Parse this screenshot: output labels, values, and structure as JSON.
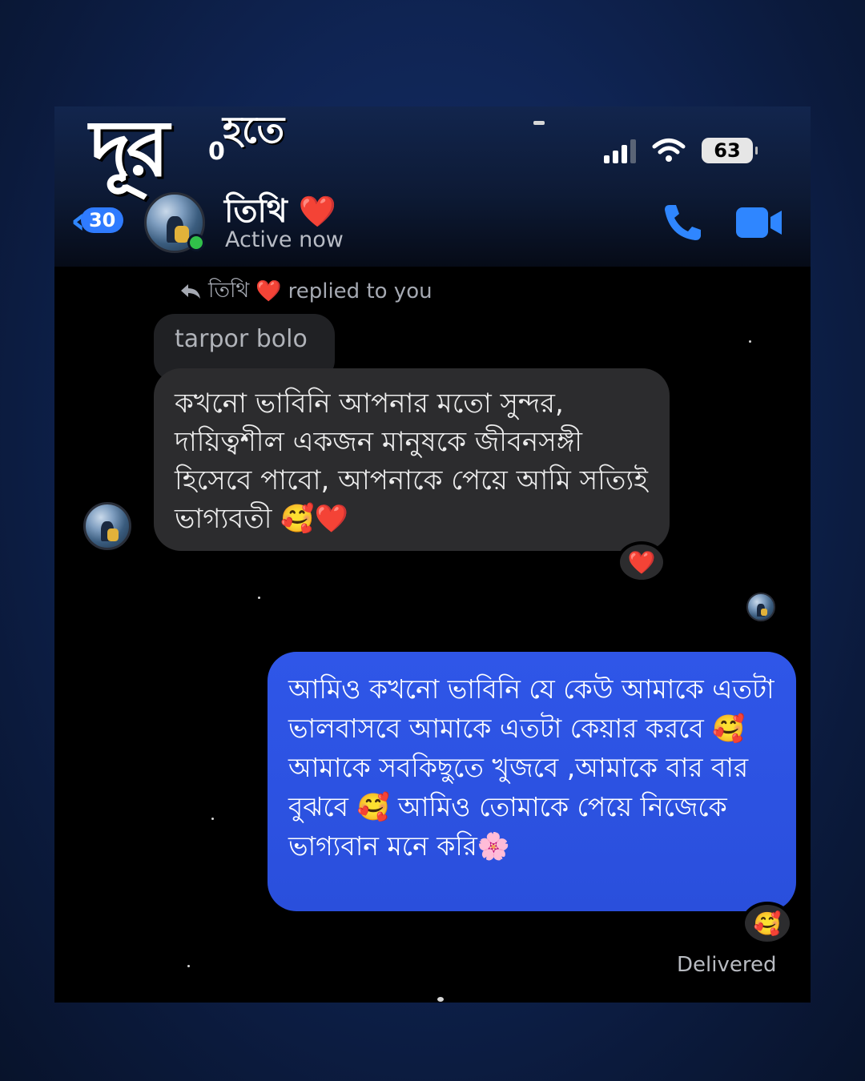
{
  "overlay": {
    "big": "দূর",
    "small": "হতে"
  },
  "status_bar": {
    "time_fragment": "0",
    "battery": "63"
  },
  "header": {
    "back_count": "30",
    "contact_name": "তিথি",
    "contact_emoji": "❤️",
    "status": "Active now"
  },
  "reply": {
    "name": "তিথি",
    "emoji": "❤️",
    "text": "replied to you"
  },
  "messages": {
    "quoted": "tarpor bolo",
    "incoming": "কখনো ভাবিনি আপনার মতো সুন্দর, দায়িত্বশীল একজন মানুষকে জীবনসঙ্গী হিসেবে পাবো, আপনাকে পেয়ে আমি সত্যিই ভাগ্যবতী 🥰❤️",
    "incoming_reaction": "❤️",
    "outgoing": "আমিও কখনো ভাবিনি যে কেউ আমাকে এতটা ভালবাসবে আমাকে এতটা কেয়ার করবে 🥰 আমাকে সবকিছুতে খুজবে ,আমাকে বার বার বুঝবে 🥰 আমিও তোমাকে পেয়ে নিজেকে ভাগ্যবান মনে করি🌸",
    "outgoing_reaction": "🥰",
    "delivered": "Delivered"
  },
  "icons": {
    "back": "chevron-left-icon",
    "call": "phone-icon",
    "video": "video-camera-icon",
    "reply": "reply-arrow-icon",
    "signal": "signal-icon",
    "wifi": "wifi-icon"
  },
  "colors": {
    "accent": "#2f86ff",
    "outgoing_bubble": "#2a4fdc",
    "incoming_bubble": "#2c2c2e",
    "online": "#31c04a"
  }
}
